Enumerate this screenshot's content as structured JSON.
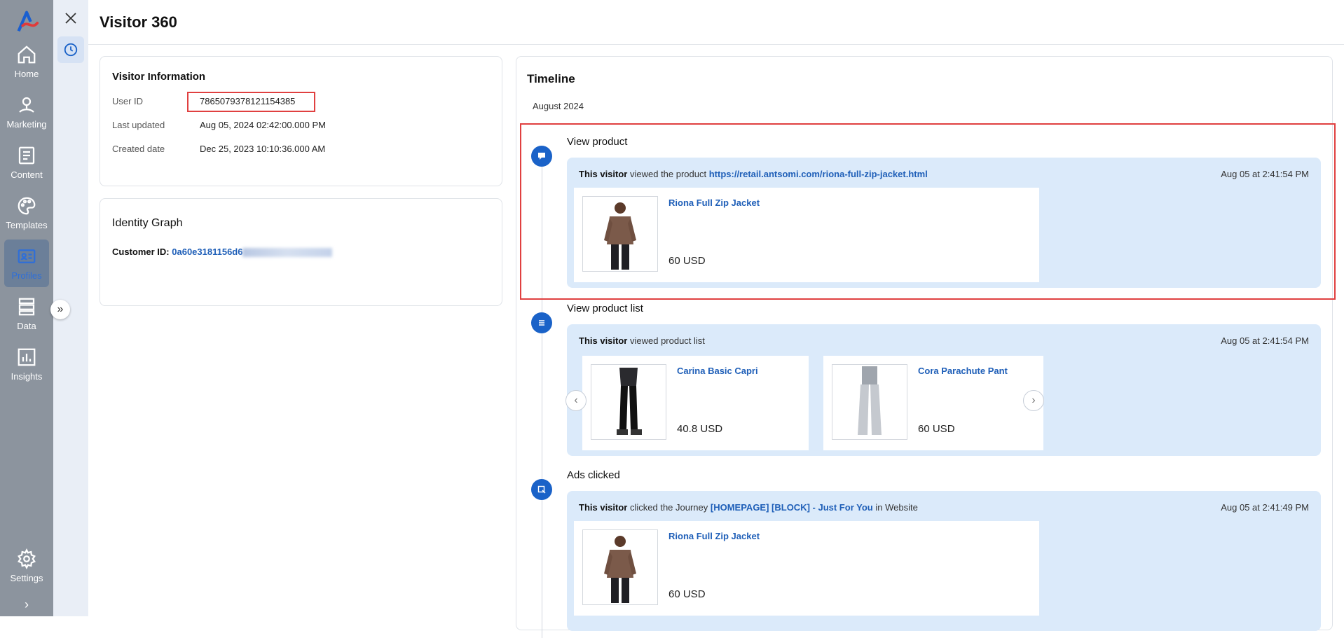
{
  "app": {
    "accent": "#1a62c8",
    "nav_bg": "#8c949e"
  },
  "nav": {
    "items": [
      {
        "label": "Home",
        "icon": "home-icon"
      },
      {
        "label": "Marketing",
        "icon": "marketing-pin-icon"
      },
      {
        "label": "Content",
        "icon": "content-doc-icon"
      },
      {
        "label": "Templates",
        "icon": "palette-icon"
      },
      {
        "label": "Profiles",
        "icon": "profile-card-icon",
        "active": true
      },
      {
        "label": "Data",
        "icon": "database-icon"
      },
      {
        "label": "Insights",
        "icon": "chart-icon"
      }
    ],
    "settings_label": "Settings"
  },
  "header": {
    "title": "Visitor 360"
  },
  "visitor_info": {
    "title": "Visitor Information",
    "rows": [
      {
        "label": "User ID",
        "value": "7865079378121154385"
      },
      {
        "label": "Last updated",
        "value": "Aug 05, 2024 02:42:00.000 PM"
      },
      {
        "label": "Created date",
        "value": "Dec 25, 2023 10:10:36.000 AM"
      }
    ]
  },
  "identity_graph": {
    "title": "Identity Graph",
    "customer_label": "Customer ID:",
    "customer_id_visible": "0a60e3181156d6"
  },
  "timeline": {
    "title": "Timeline",
    "month": "August 2024",
    "events": [
      {
        "title": "View product",
        "subject": "This visitor",
        "text": "viewed the product",
        "link": "https://retail.antsomi.com/riona-full-zip-jacket.html",
        "time": "Aug 05 at 2:41:54 PM",
        "products": [
          {
            "name": "Riona Full Zip Jacket",
            "price": "60 USD"
          }
        ]
      },
      {
        "title": "View product list",
        "subject": "This visitor",
        "text": "viewed product list",
        "time": "Aug 05 at 2:41:54 PM",
        "products": [
          {
            "name": "Carina Basic Capri",
            "price": "40.8 USD"
          },
          {
            "name": "Cora Parachute Pant",
            "price": "60 USD"
          }
        ]
      },
      {
        "title": "Ads clicked",
        "subject": "This visitor",
        "text": "clicked the Journey",
        "link": "[HOMEPAGE] [BLOCK] - Just For You",
        "suffix": "in Website",
        "time": "Aug 05 at 2:41:49 PM",
        "products": [
          {
            "name": "Riona Full Zip Jacket",
            "price": "60 USD"
          }
        ]
      }
    ]
  }
}
